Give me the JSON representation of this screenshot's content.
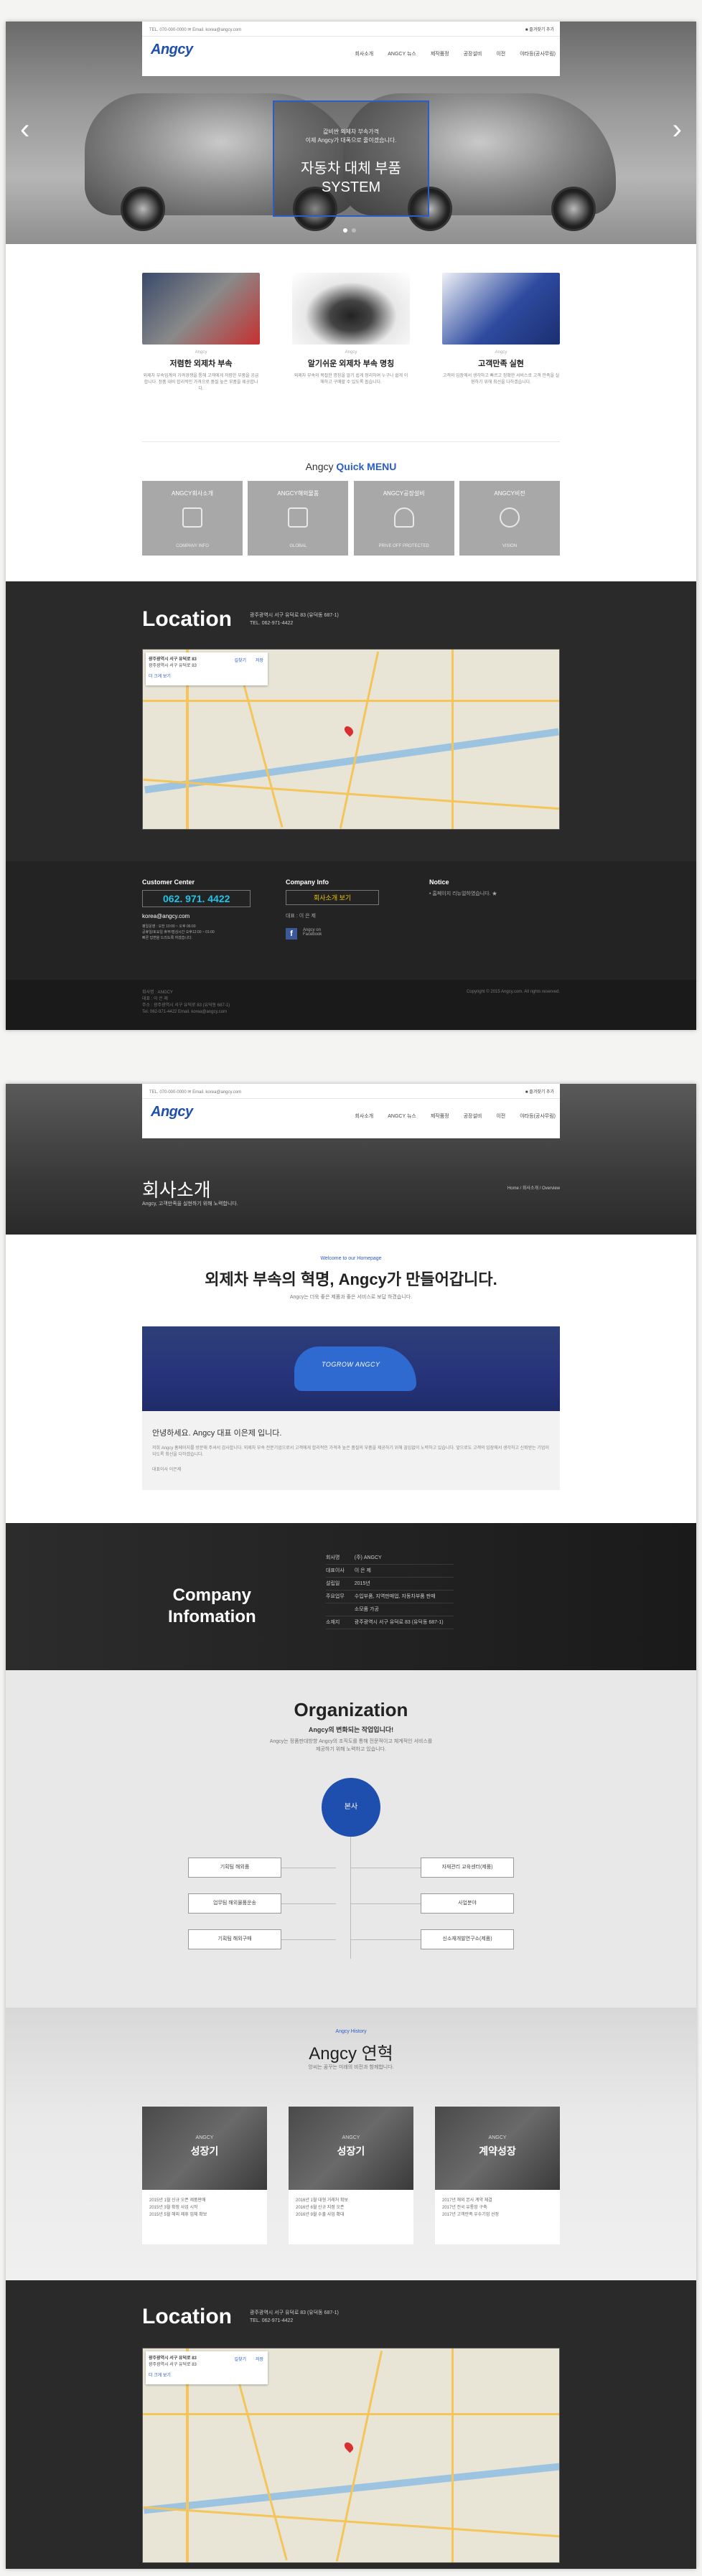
{
  "header": {
    "contact": "TEL. 070-000-0000   ✉ Email. korea@angcy.com",
    "mini_button": "■ 즐겨찾기 추가",
    "logo": "Angcy",
    "nav": [
      "회사소개",
      "ANGCY 뉴스",
      "제작품정",
      "공장설비",
      "이전",
      "야타등(공사무림)"
    ]
  },
  "hero": {
    "line1": "값비싼 외제차 부속가격",
    "line2": "이제 Angcy가 대폭으로 줄이겠습니다.",
    "title1": "자동차 대체 부품",
    "title2": "SYSTEM",
    "prev": "‹",
    "next": "›"
  },
  "features": [
    {
      "sub": "Angcy",
      "title": "저렴한 외제차 부속",
      "desc": "외제차 부속업계의 가격경쟁을 통해 고객에게 저렴한 부품을 공급합니다. 정품 대비 합리적인 가격으로 품질 높은 부품을 제공합니다."
    },
    {
      "sub": "Angcy",
      "title": "알기쉬운 외제차 부속 명칭",
      "desc": "외제차 부속의 복잡한 명칭을 알기 쉽게 정리하여 누구나 쉽게 이해하고 구매할 수 있도록 돕습니다."
    },
    {
      "sub": "Angcy",
      "title": "고객만족 실현",
      "desc": "고객의 입장에서 생각하고 빠르고 정확한 서비스로 고객 만족을 실현하기 위해 최선을 다하겠습니다."
    }
  ],
  "quick_menu": {
    "title_prefix": "Angcy",
    "title_highlight": "Quick MENU",
    "items": [
      {
        "label": "ANGCY회사소개",
        "en": "COMPANY INFO",
        "icon": "building-icon"
      },
      {
        "label": "ANGCY해외물품",
        "en": "GLOBAL",
        "icon": "map-icon"
      },
      {
        "label": "ANGCY공장설비",
        "en": "PRIVE OFF PROTECTED",
        "icon": "car-icon"
      },
      {
        "label": "ANGCY비전",
        "en": "VISION",
        "icon": "globe-icon"
      }
    ]
  },
  "location": {
    "title": "Location",
    "address": "광주광역시 서구 유덕로 83 (유덕동 687-1)",
    "tel": "TEL. 062-971-4422",
    "map_place": "광주광역시 서구 유덕로 83",
    "map_sub": "광주광역시 서구 유덕로 83",
    "map_link1": "길찾기",
    "map_link2": "저장",
    "map_link3": "더 크게 보기"
  },
  "footer": {
    "cc_title": "Customer Center",
    "phone": "062. 971. 4422",
    "email": "korea@angcy.com",
    "hours1": "평일운영 : 오전 10:00 ~ 오후 06:00",
    "hours2": "공휴일/토요일 휴무/점심시간 오후12:00 ~ 01:00",
    "hours3": "빠른 답변을 드리도록 하겠습니다.",
    "ci_title": "Company Info",
    "ci_button": "회사소개 보기",
    "ci_ceo": "대표 : 이 은 제",
    "fb_text": "Angcy on Facebook",
    "notice_title": "Notice",
    "notice_item": "• 홈페이지 리뉴얼하였습니다. ★",
    "bottom1": "회사명 : ANGCY",
    "bottom2": "대표 : 이 은 제",
    "bottom3": "주소 : 광주광역시 서구 유덕로 83 (유덕동 687-1)",
    "bottom4": "Tel. 062-971-4422    Email. korea@angcy.com",
    "copyright": "Copyright © 2015 Angcy.com. All rights reserved."
  },
  "subpage": {
    "title": "회사소개",
    "subtitle": "Angcy, 고객만족을 실현하기 위해 노력합니다.",
    "breadcrumb": "Home  /  회사소개  /  Overview",
    "kicker": "Welcome to our Homepage",
    "headline": "외제차 부속의 혁명, Angcy가 만들어갑니다.",
    "headline_sub": "Angcy는 더욱 좋은 제품과 좋은 서비스로 보답 하겠습니다.",
    "banner_text": "TOGROW ANGCY",
    "greet_title": "안녕하세요. Angcy 대표 이은제 입니다.",
    "greet_body": "저희 Angcy 홈페이지를 방문해 주셔서 감사합니다. 외제차 부속 전문기업으로서 고객에게 합리적인 가격과 높은 품질의 부품을 제공하기 위해 끊임없이 노력하고 있습니다. 앞으로도 고객의 입장에서 생각하고 신뢰받는 기업이 되도록 최선을 다하겠습니다.",
    "greet_sign": "대표이사 이은제"
  },
  "company_info": {
    "title1": "Company",
    "title2": "Infomation",
    "rows": [
      {
        "k": "회사명",
        "v": "(주) ANGCY"
      },
      {
        "k": "대표이사",
        "v": "이 은 제"
      },
      {
        "k": "설립일",
        "v": "2015년"
      },
      {
        "k": "주요업무",
        "v": "수입부품, 지역판매업, 자동차부품 판매"
      },
      {
        "k": "",
        "v": "소모품 가공"
      },
      {
        "k": "소재지",
        "v": "광주광역시 서구 유덕로 83 (유덕동 687-1)"
      }
    ]
  },
  "organization": {
    "title": "Organization",
    "sub": "Angcy의 변화되는 작업입니다!",
    "desc1": "Angcy는 정품판대방향 Angcy의 조직도를 통해 전문적이고 체계적인 서비스를",
    "desc2": "제공하기 위해 노력하고 있습니다.",
    "ceo": "본사",
    "left": [
      "기획팀 해외품",
      "업무팀 해외물품운송",
      "기획팀 해외구매"
    ],
    "right": [
      "자재관리 교육센터(제품)",
      "사업분야",
      "신소재개발연구소(제품)"
    ]
  },
  "history": {
    "kicker": "Angcy History",
    "title": "Angcy 연혁",
    "sub": "앙씨는 꿈꾸는 미래의 비전과 함께합니다.",
    "cards": [
      {
        "sm": "ANGCY",
        "lg": "성장기",
        "lines": [
          "2015년 1월 신규 오픈 제품판매",
          "2015년 3월 확장 사업 시작",
          "2015년 5월 해외 제휴 업체 확보"
        ]
      },
      {
        "sm": "ANGCY",
        "lg": "성장기",
        "lines": [
          "2016년 1월 대형 거래처 확보",
          "2016년 6월 신규 지점 오픈",
          "2016년 9월 수출 사업 확대"
        ]
      },
      {
        "sm": "ANGCY",
        "lg": "계약성장",
        "lines": [
          "2017년 해외 본사 계약 체결",
          "2017년 전국 유통망 구축",
          "2017년 고객만족 우수기업 선정"
        ]
      }
    ]
  }
}
